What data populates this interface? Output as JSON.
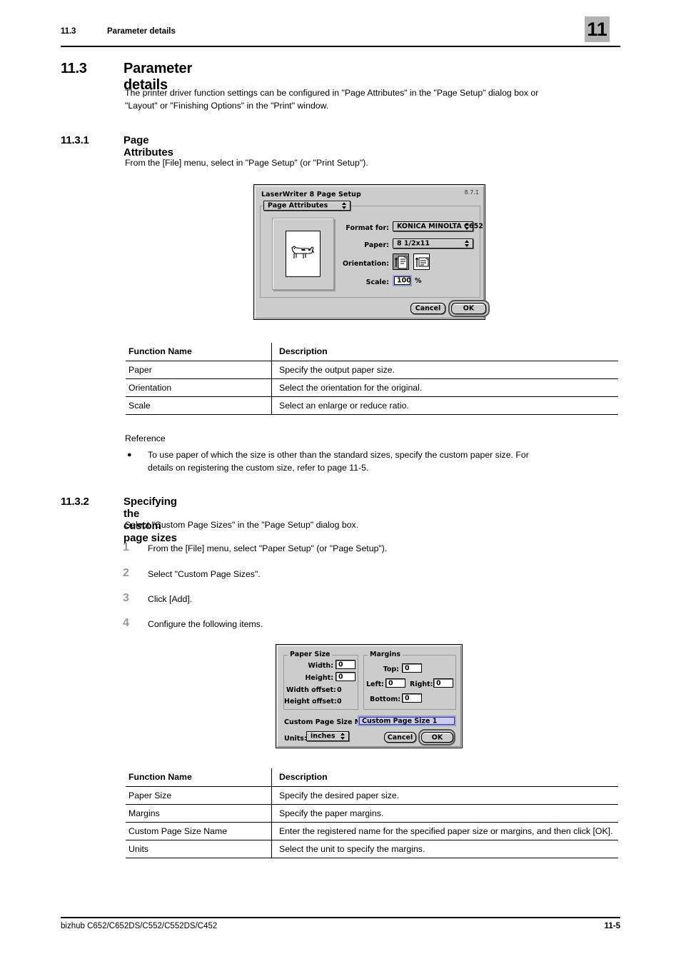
{
  "header": {
    "section_number": "11.3",
    "section_title": "Parameter details",
    "chapter_badge": "11"
  },
  "sections": {
    "h1": {
      "number": "11.3",
      "title": "Parameter details"
    },
    "intro_line1": "The printer driver function settings can be configured in \"Page Attributes\" in the \"Page Setup\" dialog box or",
    "intro_line2": "\"Layout\" or \"Finishing Options\" in the \"Print\" window.",
    "h2_1": {
      "number": "11.3.1",
      "title": "Page Attributes"
    },
    "h2_1_intro": "From the [File] menu, select in \"Page Setup\" (or \"Print Setup\").",
    "h2_2": {
      "number": "11.3.2",
      "title": "Specifying the custom page sizes"
    },
    "h2_2_intro": "Select \"Custom Page Sizes\" in the \"Page Setup\" dialog box."
  },
  "reference": {
    "label": "Reference",
    "bullet_marker": "●",
    "bullet_line1": "To use paper of which the size is other than the standard sizes, specify the custom paper size. For",
    "bullet_line2": "details on registering the custom size, refer to page 11-5."
  },
  "steps": [
    {
      "number": "1",
      "text": "From the [File] menu, select \"Paper Setup\" (or \"Page Setup\")."
    },
    {
      "number": "2",
      "text": "Select \"Custom Page Sizes\"."
    },
    {
      "number": "3",
      "text": "Click [Add]."
    },
    {
      "number": "4",
      "text": "Configure the following items."
    }
  ],
  "dialog_page_setup": {
    "title": "LaserWriter 8 Page Setup",
    "version": "8.7.1",
    "panel_popup": "Page Attributes",
    "format_for_label": "Format for:",
    "format_for_value": "KONICA MINOLTA C652",
    "paper_label": "Paper:",
    "paper_value": "8 1/2x11",
    "orientation_label": "Orientation:",
    "orientation_portrait_icon": "portrait-orientation-icon",
    "orientation_landscape_icon": "landscape-orientation-icon",
    "scale_label": "Scale:",
    "scale_value": "100",
    "scale_unit": "%",
    "cancel_label": "Cancel",
    "ok_label": "OK",
    "preview_icon": "dog-preview-icon"
  },
  "dialog_custom_page_size": {
    "paper_size_group": "Paper Size",
    "width_label": "Width:",
    "width_value": "0",
    "height_label": "Height:",
    "height_value": "0",
    "width_offset_label": "Width offset:",
    "width_offset_value": "0",
    "height_offset_label": "Height offset:",
    "height_offset_value": "0",
    "margins_group": "Margins",
    "top_label": "Top:",
    "top_value": "0",
    "left_label": "Left:",
    "left_value": "0",
    "right_label": "Right:",
    "right_value": "0",
    "bottom_label": "Bottom:",
    "bottom_value": "0",
    "name_label": "Custom Page Size Name:",
    "name_value": "Custom Page Size 1",
    "units_label": "Units:",
    "units_value": "inches",
    "cancel_label": "Cancel",
    "ok_label": "OK"
  },
  "table_1": {
    "headers": {
      "name": "Function Name",
      "description": "Description"
    },
    "rows": [
      {
        "name": "Paper",
        "description": "Specify the output paper size."
      },
      {
        "name": "Orientation",
        "description": "Select the orientation for the original."
      },
      {
        "name": "Scale",
        "description": "Select an enlarge or reduce ratio."
      }
    ]
  },
  "table_2": {
    "headers": {
      "name": "Function Name",
      "description": "Description"
    },
    "rows": [
      {
        "name": "Paper Size",
        "description": "Specify the desired paper size."
      },
      {
        "name": "Margins",
        "description": "Specify the paper margins."
      },
      {
        "name": "Custom Page Size Name",
        "description": "Enter the registered name for the specified paper size or margins, and then click [OK]."
      },
      {
        "name": "Units",
        "description": "Select the unit to specify the margins."
      }
    ]
  },
  "footer": {
    "left": "bizhub C652/C652DS/C552/C552DS/C452",
    "right": "11-5"
  }
}
